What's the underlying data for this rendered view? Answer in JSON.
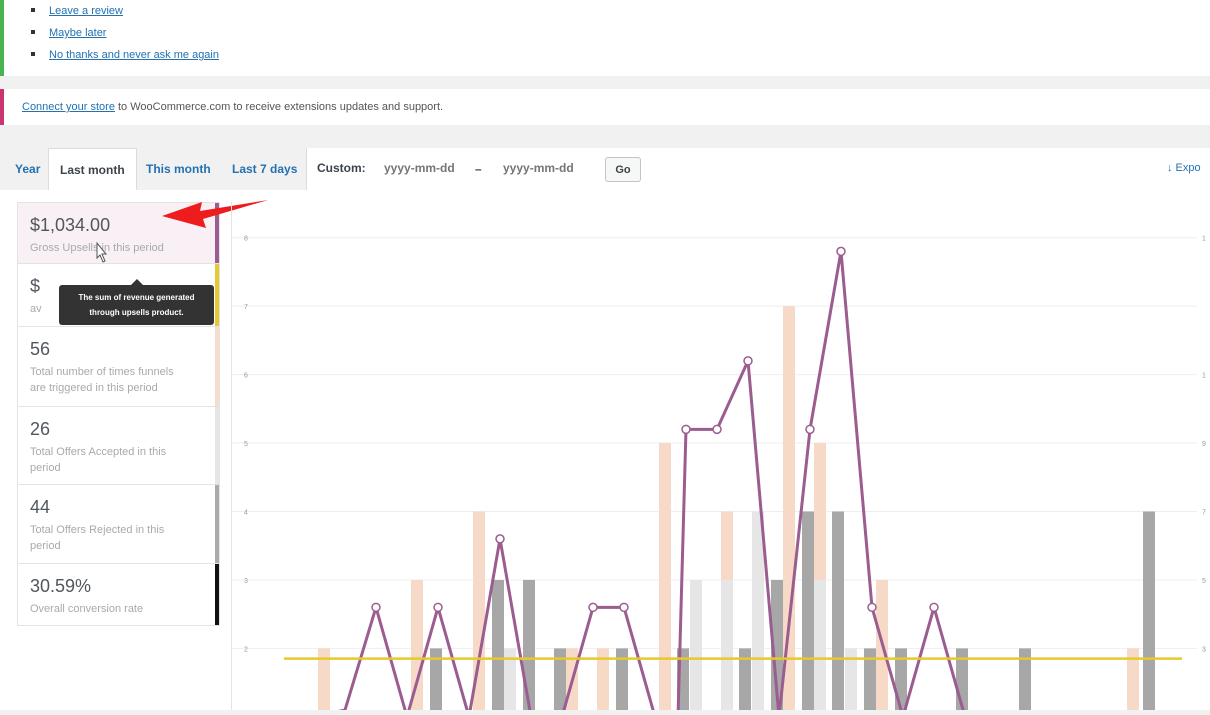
{
  "review_notice": {
    "links": [
      "Leave a review",
      "Maybe later",
      "No thanks and never ask me again"
    ]
  },
  "connect_notice": {
    "link": "Connect your store",
    "text": " to WooCommerce.com to receive extensions updates and support."
  },
  "tabs": {
    "year": "Year",
    "last_month": "Last month",
    "this_month": "This month",
    "last_7_days": "Last 7 days",
    "custom_label": "Custom:",
    "date_from_placeholder": "yyyy-mm-dd",
    "date_to_placeholder": "yyyy-mm-dd",
    "dash": "–",
    "go": "Go",
    "export": "↓ Expo"
  },
  "stats": [
    {
      "amount": "$1,034.00",
      "desc": "Gross Upsells in this period",
      "color": "#9b5c8f"
    },
    {
      "amount": "$",
      "desc": "av",
      "color": "#e5c92e"
    },
    {
      "amount": "56",
      "desc": "Total number of times funnels are triggered in this period",
      "color": "#f5dccd"
    },
    {
      "amount": "26",
      "desc": "Total Offers Accepted in this period",
      "color": "#e6e6e6"
    },
    {
      "amount": "44",
      "desc": "Total Offers Rejected in this period",
      "color": "#aaaaaa"
    },
    {
      "amount": "30.59%",
      "desc": "Overall conversion rate",
      "color": "#111111"
    }
  ],
  "tooltip": {
    "line1": "The sum of revenue generated",
    "line2": "through upsells product."
  },
  "colors": {
    "accent_purple": "#9b5c8f",
    "average_yellow": "#e5c92e",
    "arrow_red": "#ee1c1c"
  },
  "chart_data": {
    "type": "bar",
    "left_axis_ticks": [
      "8",
      "7",
      "6",
      "5",
      "4",
      "3",
      "2"
    ],
    "right_axis_ticks": [
      "1",
      "",
      "1",
      "9",
      "7",
      "5",
      "3"
    ],
    "ylim": [
      1.1,
      8.2
    ],
    "series": [
      {
        "name": "Total number of times funnels are triggered in this period",
        "color": "#f7d9c8",
        "values": [
          2,
          3,
          4,
          2,
          2,
          5,
          4,
          7,
          5,
          3,
          2
        ]
      },
      {
        "name": "Total Offers Accepted in this period",
        "color": "#e6e6e6",
        "values": [
          2,
          3,
          3,
          4,
          3,
          2
        ]
      },
      {
        "name": "Total Offers Rejected in this period",
        "color": "#a7a7a7",
        "values": [
          2,
          3,
          3,
          2,
          2,
          2,
          2,
          3,
          4,
          4,
          2,
          2,
          2,
          2,
          4
        ]
      },
      {
        "name": "Gross Upsells in this period",
        "color": "#9b5c8f",
        "values": [
          1.0,
          1.0,
          1.1,
          2.6,
          1.0,
          2.6,
          1.0,
          3.6,
          1.0,
          1.0,
          2.6,
          2.6,
          1.0,
          1.0,
          5.2,
          5.2,
          6.2,
          1.0,
          5.2,
          7.8,
          2.6,
          1.0,
          2.6,
          1.0
        ]
      },
      {
        "name": "av",
        "color": "#e5c92e",
        "values": [
          1.85
        ]
      }
    ]
  }
}
